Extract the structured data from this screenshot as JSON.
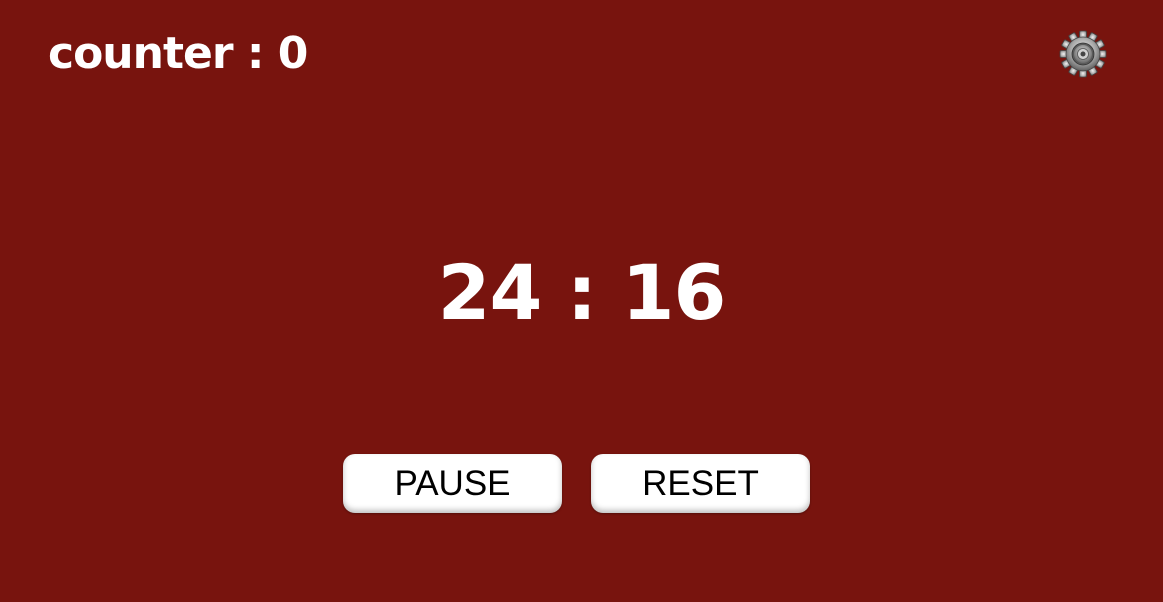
{
  "counter": {
    "label": "counter : 0"
  },
  "settings": {
    "icon": "gear-icon"
  },
  "timer": {
    "display": "24 : 16"
  },
  "controls": {
    "pause_label": "PAUSE",
    "reset_label": "RESET"
  },
  "colors": {
    "background": "#78140e",
    "text": "#ffffff",
    "button_bg": "#ffffff",
    "button_text": "#000000"
  }
}
